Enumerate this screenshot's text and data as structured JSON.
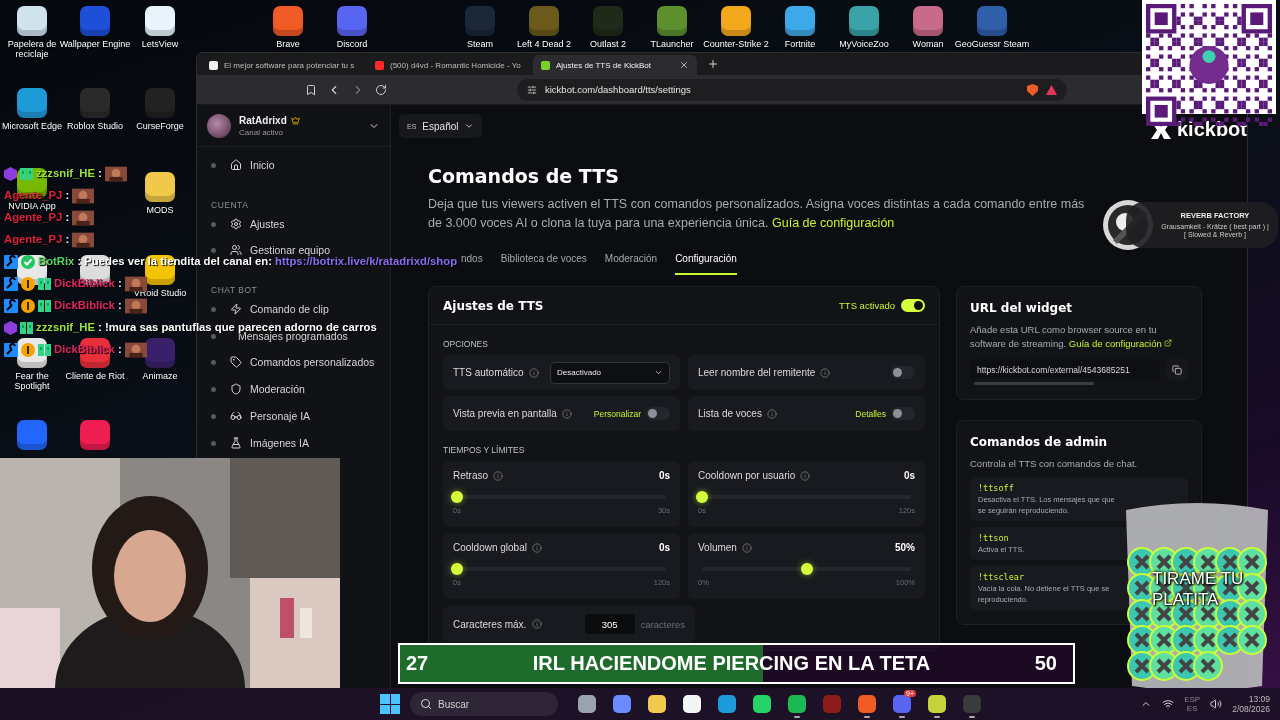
{
  "desktop_icons": [
    {
      "label": "Papelera de reciclaje",
      "color": "#cfe3ef"
    },
    {
      "label": "Wallpaper Engine",
      "color": "#1d4fd8"
    },
    {
      "label": "LetsView",
      "color": "#e8f4fb"
    },
    {
      "label": "Brave",
      "color": "#f05a24"
    },
    {
      "label": "Discord",
      "color": "#5865f2"
    },
    {
      "label": "Steam",
      "color": "#1b2838"
    },
    {
      "label": "Left 4 Dead 2",
      "color": "#6b5a1c"
    },
    {
      "label": "Outlast 2",
      "color": "#1f2a1a"
    },
    {
      "label": "TLauncher",
      "color": "#5d8f2f"
    },
    {
      "label": "Counter-Strike 2",
      "color": "#f3a81c"
    },
    {
      "label": "Fortnite",
      "color": "#3ea9e8"
    },
    {
      "label": "MyVoiceZoo",
      "color": "#39a3a8"
    },
    {
      "label": "Woman",
      "color": "#c86a8a"
    },
    {
      "label": "GeoGuessr Steam",
      "color": "#2f5fa8"
    },
    {
      "label": "Microsoft Edge",
      "color": "#1f9ad8"
    },
    {
      "label": "Roblox Studio",
      "color": "#2a2a2a"
    },
    {
      "label": "CurseForge",
      "color": "#222222"
    },
    {
      "label": "NVIDIA App",
      "color": "#76b900"
    },
    {
      "label": "MODS",
      "color": "#f1c84a"
    },
    {
      "color": "#e8e8e8"
    },
    {
      "color": "#dddddd"
    },
    {
      "label": "VRoid Studio",
      "color": "#f5c400"
    },
    {
      "label": "Fear the Spotlight",
      "color": "#e8e8e8"
    },
    {
      "label": "Cliente de Riot",
      "color": "#e8303a"
    },
    {
      "label": "Animaze",
      "color": "#3a1f6b"
    },
    {
      "color": "#2266ff"
    },
    {
      "color": "#ee1d52"
    }
  ],
  "browser": {
    "tabs": [
      {
        "title": "El mejor software para potenciar tu s",
        "selected": false
      },
      {
        "title": "(500) d4vd - Romantic Homicide - Yo",
        "selected": false
      },
      {
        "title": "Ajustes de TTS de KickBot",
        "selected": true
      }
    ],
    "url": "kickbot.com/dashboard/tts/settings"
  },
  "sidebar": {
    "user": {
      "name": "RatAdrixd",
      "status": "Canal activo"
    },
    "sections": [
      {
        "items": [
          {
            "label": "Inicio"
          }
        ]
      },
      {
        "heading": "CUENTA",
        "items": [
          {
            "label": "Ajustes"
          },
          {
            "label": "Gestionar equipo"
          }
        ]
      },
      {
        "heading": "CHAT BOT",
        "items": [
          {
            "label": "Comando de clip"
          },
          {
            "label": "Mensajes programados"
          },
          {
            "label": "Comandos personalizados"
          },
          {
            "label": "Moderación"
          },
          {
            "label": "Personaje IA"
          },
          {
            "label": "Imágenes IA"
          }
        ]
      }
    ]
  },
  "page": {
    "language_code": "ES",
    "language": "Español",
    "logo": "kickbot",
    "title": "Comandos de TTS",
    "description": "Deja que tus viewers activen el TTS con comandos personalizados. Asigna voces distintas a cada comando entre más de 3.000 voces AI o clona la tuya para una experiencia única.",
    "guide_link": "Guía de configuración",
    "tabs": [
      {
        "label": "ndos",
        "selected": false
      },
      {
        "label": "Biblioteca de voces",
        "selected": false
      },
      {
        "label": "Moderación",
        "selected": false
      },
      {
        "label": "Configuración",
        "selected": true
      }
    ],
    "tts_card": {
      "title": "Ajustes de TTS",
      "toggle": {
        "label": "TTS activado",
        "on": true
      },
      "options_heading": "OPCIONES",
      "options": [
        {
          "kind": "select",
          "label": "TTS automático",
          "value": "Desactivado"
        },
        {
          "kind": "toggle",
          "label": "Leer nombre del remitente",
          "on": false
        },
        {
          "kind": "toggle",
          "label": "Vista previa en pantalla",
          "link": "Personalizar",
          "on": false
        },
        {
          "kind": "toggle",
          "label": "Lista de voces",
          "link": "Detalles",
          "on": false
        }
      ],
      "limits_heading": "TIEMPOS Y LÍMITES",
      "sliders": [
        {
          "label": "Retraso",
          "value": "0s",
          "min": "0s",
          "max": "30s",
          "level": 0
        },
        {
          "label": "Cooldown por usuario",
          "value": "0s",
          "min": "0s",
          "max": "120s",
          "level": 0
        },
        {
          "label": "Cooldown global",
          "value": "0s",
          "min": "0s",
          "max": "120s",
          "level": 0
        },
        {
          "label": "Volumen",
          "value": "50%",
          "min": "0%",
          "max": "100%",
          "level": 0.5
        }
      ],
      "max_chars": {
        "label": "Caracteres máx.",
        "value": "305",
        "unit": "caracteres"
      }
    },
    "widget_card": {
      "title": "URL del widget",
      "description": "Añade esta URL como browser source en tu software de streaming.",
      "link": "Guía de configuración",
      "url": "https://kickbot.com/external/4543685251"
    },
    "admin_card": {
      "title": "Comandos de admin",
      "description": "Controla el TTS con comandos de chat.",
      "commands": [
        {
          "command": "!ttsoff",
          "lines": [
            "Desactiva el TTS. Los mensajes que que",
            "se seguirán reproduciendo."
          ]
        },
        {
          "command": "!ttson",
          "lines": [
            "Activa el TTS."
          ]
        },
        {
          "command": "!ttsclear",
          "lines": [
            "Vacía la cola. No detiene el TTS que se",
            "reproduciendo."
          ]
        }
      ]
    }
  },
  "chat": [
    {
      "user": "zzzsnif_HE",
      "color": "#9be33c",
      "badges": [
        {
          "kind": "gem"
        },
        {
          "kind": "sub"
        }
      ],
      "text": ":",
      "emote": true
    },
    {
      "user": "Agente_PJ",
      "color": "#e0203c",
      "text": ":",
      "emote": true
    },
    {
      "user": "Agente_PJ",
      "color": "#e0203c",
      "text": ":",
      "emote": true
    },
    {
      "user": "Agente_PJ",
      "color": "#e0203c",
      "text": ":",
      "emote": true
    },
    {
      "user": "BotRix",
      "color": "#5fd35f",
      "badges": [
        {
          "kind": "mod"
        },
        {
          "kind": "verified"
        }
      ],
      "text": ": Puedes ver la tiendita del canal en:",
      "link": "https://botrix.live/k/ratadrixd/shop",
      "emote": false
    },
    {
      "user": "DickBiblick",
      "color": "#e0245e",
      "badges": [
        {
          "kind": "mod"
        },
        {
          "kind": "gift"
        },
        {
          "kind": "sub"
        }
      ],
      "text": ":",
      "emote": true
    },
    {
      "user": "DickBiblick",
      "color": "#e0245e",
      "badges": [
        {
          "kind": "mod"
        },
        {
          "kind": "gift"
        },
        {
          "kind": "sub"
        }
      ],
      "text": ":",
      "emote": true
    },
    {
      "user": "zzzsnif_HE",
      "color": "#9be33c",
      "badges": [
        {
          "kind": "gem"
        },
        {
          "kind": "sub"
        }
      ],
      "text": ": !mura sas pantuflas que parecen adorno de carros",
      "emote": false
    },
    {
      "user": "DickBiblick",
      "color": "#e0245e",
      "badges": [
        {
          "kind": "mod"
        },
        {
          "kind": "gift"
        },
        {
          "kind": "sub"
        }
      ],
      "text": ":",
      "emote": true
    }
  ],
  "now_playing": {
    "title": "REVERB FACTORY",
    "track": "Grausamkeit - Krätze ( best part ) | [ Slowed & Reverb ]"
  },
  "cup": {
    "text": "TIRAME TU PLATITA"
  },
  "goal": {
    "current": "27",
    "title": "IRL HACIENDOME PIERCING EN LA TETA",
    "target": "50",
    "level": 0.54
  },
  "taskbar": {
    "search_placeholder": "Buscar",
    "apps": [
      {
        "color": "#9aa3ad",
        "running": false
      },
      {
        "color": "#6b8cff",
        "running": false
      },
      {
        "color": "#f2c94c",
        "running": false
      },
      {
        "color": "#f5f5f5",
        "running": false
      },
      {
        "color": "#1f9ad8",
        "running": false
      },
      {
        "color": "#25d366",
        "running": false
      },
      {
        "color": "#1db954",
        "running": true
      },
      {
        "color": "#8b1a1a",
        "running": false
      },
      {
        "color": "#f05a24",
        "running": true
      },
      {
        "color": "#5865f2",
        "running": true,
        "badge": "9+"
      },
      {
        "color": "#c7d23a",
        "running": true
      },
      {
        "color": "#3a3a3a",
        "running": true
      }
    ],
    "lang": "ESP",
    "layout": "ES",
    "time": "13:09",
    "date": "2/08/2026"
  }
}
